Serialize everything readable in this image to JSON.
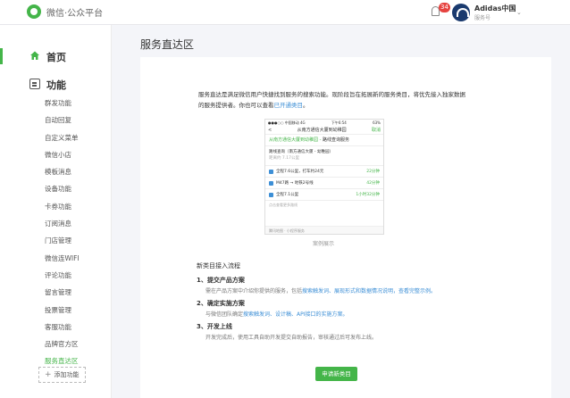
{
  "header": {
    "brand": "微信·公众平台",
    "notification_count": "34",
    "account_name": "Adidas中国",
    "account_type": "服务号",
    "caret": "⌄"
  },
  "sidebar": {
    "home_label": "首页",
    "function_label": "功能",
    "items": [
      "群发功能",
      "自动回复",
      "自定义菜单",
      "微信小店",
      "模板消息",
      "设备功能",
      "卡券功能",
      "订阅消息",
      "门店管理",
      "微信连WIFI",
      "评论功能",
      "留言管理",
      "投票管理",
      "客服功能",
      "品牌官方区",
      "服务直达区"
    ],
    "active_index": 15,
    "add_plus": "+",
    "add_label": "添加功能"
  },
  "main": {
    "title": "服务直达区",
    "intro_text": "服务直达是满足微信用户快捷找到服务的搜索功能。现阶段旨在拓展新的服务类目，将优先接入独家数据的服务提供者。你也可以查看",
    "intro_link": "已开通类目",
    "intro_end": "。",
    "caption": "案例展示",
    "apply_button": "申请新类目"
  },
  "phone": {
    "status_left": "●●●○○ 中国移动 4G",
    "status_time": "下午6:54",
    "status_right": "63%",
    "nav_back": "<",
    "nav_title": "从南方通信大厦到幼稚园",
    "nav_action": "取消",
    "banner_green": "从南方通信大厦到幼稚园",
    "banner_dark": "路线查询服务",
    "route_line1": "路线查询（南方通信大厦 - 幼稚园）",
    "route_line2": "距离约 7.17公里",
    "rows": [
      {
        "text": "全程7.6公里，打车约24元",
        "time": "22分钟"
      },
      {
        "text": "M47路 → 地铁2号线",
        "time": "42分钟"
      },
      {
        "text": "全程7.1公里",
        "time": "1小时32分钟"
      }
    ],
    "more": "点击查看更多路线",
    "footer": "腾讯地图 · 小程序服务"
  },
  "flow": {
    "title": "新类目接入流程",
    "steps": [
      {
        "step": "1、提交产品方案",
        "desc": "需在产品方案中介绍你提供的服务，包括",
        "link": "搜索触发词、展现形式和数据情况说明，查看完整示例。"
      },
      {
        "step": "2、确定实施方案",
        "desc": "与微信团队确定",
        "link": "搜索触发词、设计稿、API接口的实施方案。"
      },
      {
        "step": "3、开发上线",
        "desc": "开发完成后，使用工具自助开发提交自助报告，审核通过后可发布上线。",
        "link": ""
      }
    ]
  },
  "colors": {
    "accent": "#44b549",
    "link": "#3d8fd6",
    "badge": "#e64340",
    "main_bg": "#f4f5f9"
  },
  "icons": {
    "logo": "wechat-logo-icon",
    "bell": "bell-icon",
    "home": "home-icon",
    "function": "function-icon",
    "avatar": "adidas-avatar"
  }
}
